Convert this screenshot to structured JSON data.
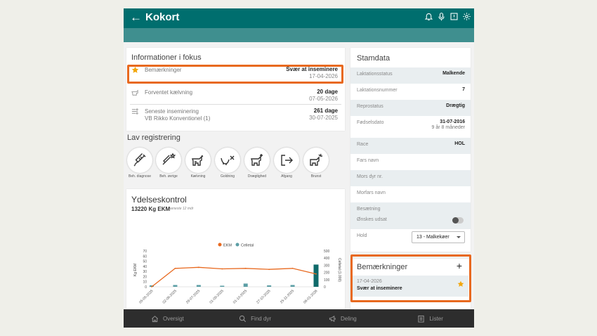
{
  "header": {
    "title": "Kokort",
    "back_icon": "arrow-left-icon"
  },
  "focus": {
    "title": "Informationer i fokus",
    "rows": [
      {
        "icon": "star-icon",
        "label": "Bemærkninger",
        "sub": "",
        "value": "Svær at inseminere",
        "date": "17-04-2026"
      },
      {
        "icon": "calving-icon",
        "label": "Forventet kælvning",
        "sub": "",
        "value": "20 dage",
        "date": "07-05-2026"
      },
      {
        "icon": "insemination-icon",
        "label": "Seneste inseminering",
        "sub": "VB Rikko Konventionel (1)",
        "value": "261 dage",
        "date": "30-07-2025"
      }
    ]
  },
  "lav": {
    "title": "Lav registrering",
    "buttons": [
      {
        "label": "Beh. diagnose",
        "icon": "syringe-icon"
      },
      {
        "label": "Beh. øvrige",
        "icon": "syringe-star-icon"
      },
      {
        "label": "Kælvning",
        "icon": "cow-calving-icon"
      },
      {
        "label": "Goldning",
        "icon": "udder-x-icon"
      },
      {
        "label": "Drægtighed",
        "icon": "cow-pregnant-icon"
      },
      {
        "label": "Afgang",
        "icon": "exit-icon"
      },
      {
        "label": "Brunst",
        "icon": "cow-heat-icon"
      }
    ]
  },
  "ydelse": {
    "title": "Ydelseskontrol",
    "summary": "13220 Kg EKM",
    "period": "seneste 12 mdr"
  },
  "chart_data": {
    "type": "bar",
    "categories": [
      "05-05-2025",
      "02-06-2025",
      "29-07-2025",
      "01-09-2025",
      "01-10-2025",
      "27-10-2025",
      "25-11-2025",
      "06-01-2026"
    ],
    "series": [
      {
        "name": "EKM",
        "kind": "line",
        "axis": "left",
        "color": "#e8691f",
        "values": [
          0,
          36,
          38,
          35,
          36,
          34,
          36,
          25
        ]
      },
      {
        "name": "Celletal",
        "kind": "bar",
        "axis": "right",
        "color": "#5c9ea5",
        "values": [
          20,
          25,
          25,
          15,
          45,
          20,
          25,
          310
        ]
      }
    ],
    "ylabel": "Kg EKM",
    "y2label": "Celletal (1.000)",
    "ylim": [
      0,
      70
    ],
    "y2lim": [
      0,
      500
    ],
    "yticks": [
      0,
      10,
      20,
      30,
      40,
      50,
      60,
      70
    ],
    "y2ticks": [
      0,
      100,
      200,
      300,
      400,
      500
    ],
    "legend": "top-center",
    "grid": false
  },
  "stamdata": {
    "title": "Stamdata",
    "rows": [
      {
        "key": "Laktationsstatus",
        "value": "Malkende",
        "sub": ""
      },
      {
        "key": "Laktationsnummer",
        "value": "7",
        "sub": ""
      },
      {
        "key": "Reprostatus",
        "value": "Drægtig",
        "sub": ""
      },
      {
        "key": "Fødselsdato",
        "value": "31-07-2016",
        "sub": "9 år 8 måneder"
      },
      {
        "key": "Race",
        "value": "HOL",
        "sub": ""
      },
      {
        "key": "Fars navn",
        "value": "",
        "sub": ""
      },
      {
        "key": "Mors dyr nr.",
        "value": "",
        "sub": ""
      },
      {
        "key": "Morfars navn",
        "value": "",
        "sub": ""
      },
      {
        "key": "Besætning",
        "value": "",
        "sub": ""
      }
    ],
    "onskes_label": "Ønskes udsat",
    "hold_label": "Hold",
    "hold_value": "13 - Malkekøer"
  },
  "bemaerkninger": {
    "title": "Bemærkninger",
    "add": "+",
    "item_date": "17-04-2026",
    "item_text": "Svær at inseminere"
  },
  "bottom": [
    {
      "label": "Oversigt",
      "icon": "home-icon"
    },
    {
      "label": "Find dyr",
      "icon": "search-icon"
    },
    {
      "label": "Deling",
      "icon": "megaphone-icon"
    },
    {
      "label": "Lister",
      "icon": "list-icon"
    }
  ],
  "colors": {
    "primary": "#006e6e",
    "highlight": "#e8691f",
    "star": "#f2a60c"
  }
}
